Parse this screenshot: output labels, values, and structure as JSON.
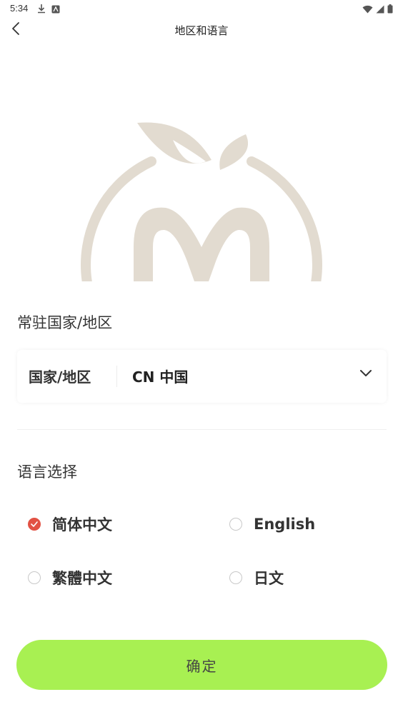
{
  "status_bar": {
    "time": "5:34"
  },
  "header": {
    "title": "地区和语言"
  },
  "region_section": {
    "heading": "常驻国家/地区",
    "field_label": "国家/地区",
    "selected_value": "CN 中国"
  },
  "language_section": {
    "heading": "语言选择",
    "options": [
      {
        "label": "简体中文",
        "selected": true
      },
      {
        "label": "English",
        "selected": false
      },
      {
        "label": "繁體中文",
        "selected": false
      },
      {
        "label": "日文",
        "selected": false
      }
    ]
  },
  "confirm_button": {
    "label": "确定"
  },
  "colors": {
    "accent_red": "#e25244",
    "button_green": "#a8f052",
    "logo_beige": "#e2dbd0"
  }
}
